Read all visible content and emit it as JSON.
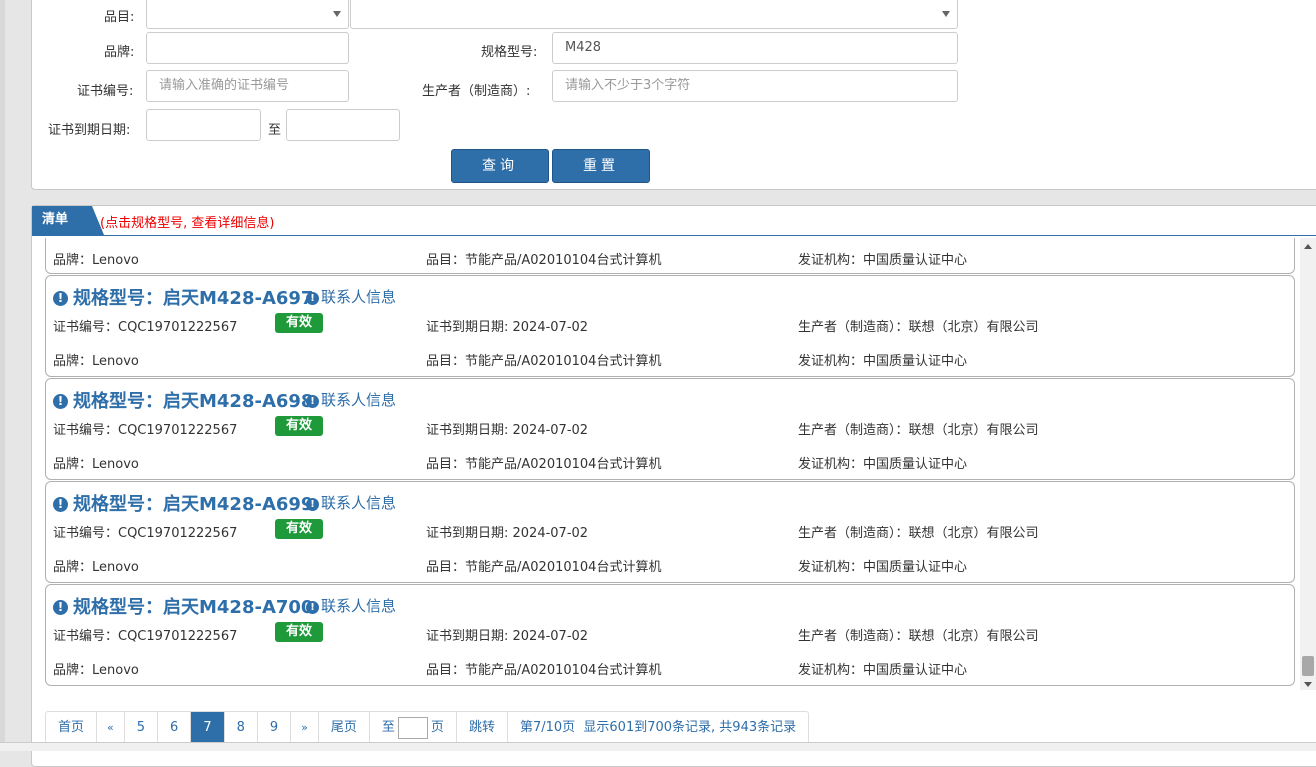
{
  "search": {
    "category_label": "品目:",
    "brand_label": "品牌:",
    "brand_value": "",
    "model_label": "规格型号:",
    "model_value": "M428",
    "cert_label": "证书编号:",
    "cert_placeholder": "请输入准确的证书编号",
    "maker_label": "生产者（制造商）:",
    "maker_placeholder": "请输入不少于3个字符",
    "expiry_label": "证书到期日期:",
    "expiry_to": "至",
    "query_button": "查询",
    "reset_button": "重置"
  },
  "list": {
    "tab_label": "清单",
    "tab_note": "(点击规格型号, 查看详细信息)",
    "partial_row": {
      "brand": "品牌：Lenovo",
      "category": "品目：节能产品/A02010104台式计算机",
      "issuer": "发证机构：中国质量认证中心"
    },
    "items": [
      {
        "title": "规格型号：启天M428-A697",
        "contact": "联系人信息",
        "cert": "证书编号：CQC19701222567",
        "status": "有效",
        "expiry": "证书到期日期: 2024-07-02",
        "maker": "生产者（制造商）：联想（北京）有限公司",
        "brand": "品牌：Lenovo",
        "category": "品目：节能产品/A02010104台式计算机",
        "issuer": "发证机构：中国质量认证中心"
      },
      {
        "title": "规格型号：启天M428-A698",
        "contact": "联系人信息",
        "cert": "证书编号：CQC19701222567",
        "status": "有效",
        "expiry": "证书到期日期: 2024-07-02",
        "maker": "生产者（制造商）：联想（北京）有限公司",
        "brand": "品牌：Lenovo",
        "category": "品目：节能产品/A02010104台式计算机",
        "issuer": "发证机构：中国质量认证中心"
      },
      {
        "title": "规格型号：启天M428-A699",
        "contact": "联系人信息",
        "cert": "证书编号：CQC19701222567",
        "status": "有效",
        "expiry": "证书到期日期: 2024-07-02",
        "maker": "生产者（制造商）：联想（北京）有限公司",
        "brand": "品牌：Lenovo",
        "category": "品目：节能产品/A02010104台式计算机",
        "issuer": "发证机构：中国质量认证中心"
      },
      {
        "title": "规格型号：启天M428-A700",
        "contact": "联系人信息",
        "cert": "证书编号：CQC19701222567",
        "status": "有效",
        "expiry": "证书到期日期: 2024-07-02",
        "maker": "生产者（制造商）：联想（北京）有限公司",
        "brand": "品牌：Lenovo",
        "category": "品目：节能产品/A02010104台式计算机",
        "issuer": "发证机构：中国质量认证中心"
      }
    ]
  },
  "pager": {
    "first": "首页",
    "prev": "«",
    "pages": [
      "5",
      "6",
      "7",
      "8",
      "9"
    ],
    "current": "7",
    "next": "»",
    "last": "尾页",
    "goto_prefix": "至",
    "goto_suffix": "页",
    "jump": "跳转",
    "summary": "第7/10页  显示601到700条记录, 共943条记录"
  },
  "colors": {
    "accent": "#2e6ea9",
    "valid_badge": "#1e9a3b",
    "note_red": "#e00000"
  }
}
